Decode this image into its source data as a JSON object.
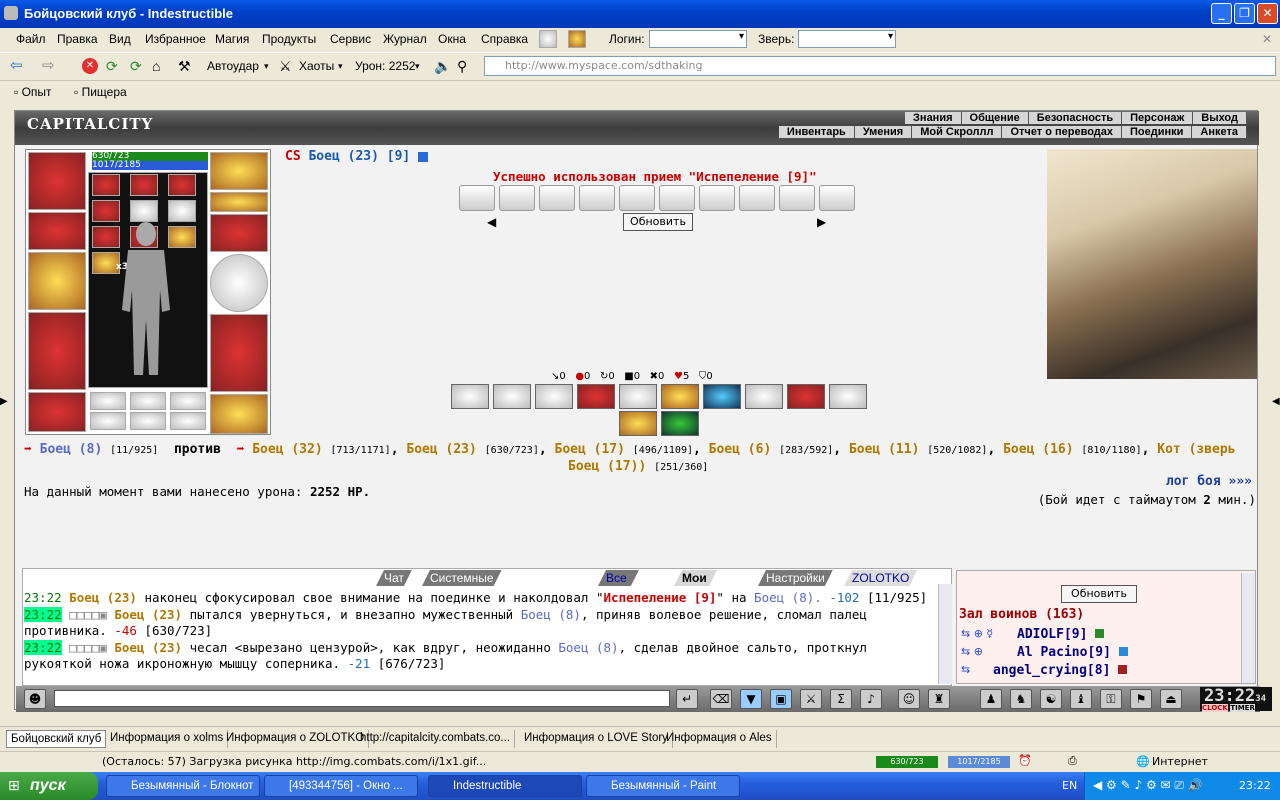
{
  "window": {
    "title": "Бойцовский клуб - Indestructible"
  },
  "menu": {
    "items": [
      "Файл",
      "Правка",
      "Вид",
      "Избранное",
      "Магия",
      "Продукты",
      "Сервис",
      "Журнал",
      "Окна",
      "Справка"
    ],
    "login_label": "Логин:",
    "beast_label": "Зверь:"
  },
  "toolbar": {
    "autostrike": "Автоудар",
    "chaots": "Хаоты",
    "damage": "Урон: 2252",
    "address": "http://www.myspace.com/sdthaking"
  },
  "links": {
    "opyt": "Опыт",
    "pishera": "Пищера"
  },
  "game": {
    "logo": "CAPITALCITY",
    "nav_top": [
      "Знания",
      "Общение",
      "Безопасность",
      "Персонаж",
      "Выход"
    ],
    "nav_bottom": [
      "Инвентарь",
      "Умения",
      "Мой Скроллл",
      "Отчет о переводах",
      "Поединки",
      "Анкета"
    ],
    "hp": "630/723",
    "mana": "1017/2185",
    "x3": "x3",
    "cs": "CS",
    "fighter": "Боец (23) [9]",
    "success": "Успешно использован прием \"Испепеление [9]\"",
    "refresh": "Обновить",
    "stats": [
      "0",
      "0",
      "0",
      "0",
      "0",
      "5",
      "0"
    ],
    "battle": {
      "me": "Боец (8)",
      "me_hp": "[11/925]",
      "vs": "против",
      "enemies": [
        {
          "n": "Боец (32)",
          "hp": "[713/1171]"
        },
        {
          "n": "Боец (23)",
          "hp": "[630/723]"
        },
        {
          "n": "Боец (17)",
          "hp": "[496/1109]"
        },
        {
          "n": "Боец (6)",
          "hp": "[283/592]"
        },
        {
          "n": "Боец (11)",
          "hp": "[520/1082]"
        },
        {
          "n": "Боец (16)",
          "hp": "[810/1180]"
        }
      ],
      "pet1": "Кот (зверь",
      "pet2": "Боец (17))",
      "pet_hp": "[251/360]"
    },
    "damage_text": "На данный момент вами нанесено урона:",
    "damage_val": "2252 HP.",
    "log_link": "лог боя »»»",
    "timeout_a": "(Бой идет с таймаутом",
    "timeout_b": "2",
    "timeout_c": "мин.)"
  },
  "tabs": [
    "Чат",
    "Системные сообщения",
    "Все логи",
    "Мои логи",
    "Настройки",
    "ZOLOTKO"
  ],
  "chat": [
    {
      "time": "23:22",
      "actor": "Боец (23)",
      "t1": "наконец сфокусировал свое внимание на поединке и наколдовал \"",
      "skill": "Испепеление [9]",
      "t2": "\" на",
      "target": "Боец (8).",
      "dmg": "-102",
      "hp": "[11/925]"
    },
    {
      "time": "23:22",
      "actor": "Боец (23)",
      "t1": "пытался увернуться, и внезапно мужественный",
      "target": "Боец (8)",
      "t2": ", приняв волевое решение, сломал палец противника.",
      "dmg": "-46",
      "hp": "[630/723]"
    },
    {
      "time": "23:22",
      "actor": "Боец (23)",
      "t1": "чесал <вырезано цензурой>, как вдруг, неожиданно",
      "target": "Боец (8)",
      "t2": ", сделав двойное сальто, проткнул рукояткой ножа икроножную мышцу соперника.",
      "dmg": "-21",
      "hp": "[676/723]"
    }
  ],
  "room": {
    "refresh": "Обновить",
    "hall": "Зал воинов (163)",
    "users": [
      "ADIOLF[9]",
      "Al Pacino[9]",
      "angel_crying[8]"
    ]
  },
  "clock": {
    "time": "23:22",
    "sec": "34",
    "clock_lbl": "CLOCK",
    "timer_lbl": "TIMER"
  },
  "linkstrip": [
    "Бойцовский клуб",
    "Информация о xolms",
    "Информация о ZOLOTKO",
    "http://capitalcity.combats.co...",
    "Информация о LOVE Story",
    "Информация о Ales"
  ],
  "status": {
    "text": "(Осталось: 57) Загрузка рисунка http://img.combats.com/i/1x1.gif...",
    "hp": "630/723",
    "mp": "1017/2185",
    "zone": "Интернет"
  },
  "taskbar": {
    "start": "пуск",
    "tasks": [
      "Безымянный - Блокнот",
      "[493344756] - Окно ...",
      "Indestructible",
      "Безымянный - Paint"
    ],
    "lang": "EN",
    "time": "23:22"
  }
}
